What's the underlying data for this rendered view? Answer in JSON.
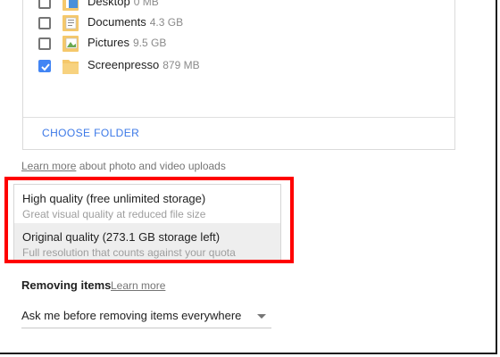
{
  "folders": [
    {
      "name": "Desktop",
      "size": "0 MB",
      "checked": false
    },
    {
      "name": "Documents",
      "size": "4.3 GB",
      "checked": false
    },
    {
      "name": "Pictures",
      "size": "9.5 GB",
      "checked": false
    },
    {
      "name": "Screenpresso",
      "size": "879 MB",
      "checked": true
    }
  ],
  "choose_folder_label": "CHOOSE FOLDER",
  "uploads_info": {
    "link": "Learn more",
    "text": " about photo and video uploads"
  },
  "quality_options": [
    {
      "title": "High quality (free unlimited storage)",
      "subtitle": "Great visual quality at reduced file size",
      "selected": false
    },
    {
      "title": "Original quality (273.1 GB storage left)",
      "subtitle": "Full resolution that counts against your quota",
      "selected": true
    }
  ],
  "removing": {
    "title": "Removing items",
    "learn_more": "Learn more",
    "select_value": "Ask me before removing items everywhere"
  },
  "colors": {
    "accent": "#4285f4",
    "link": "#3b78e7",
    "highlight": "#ff0000",
    "folder": "#f5c86b"
  },
  "icons": {
    "folder": "folder-icon",
    "check": "checkmark-icon",
    "dropdown": "dropdown-arrow-icon"
  }
}
